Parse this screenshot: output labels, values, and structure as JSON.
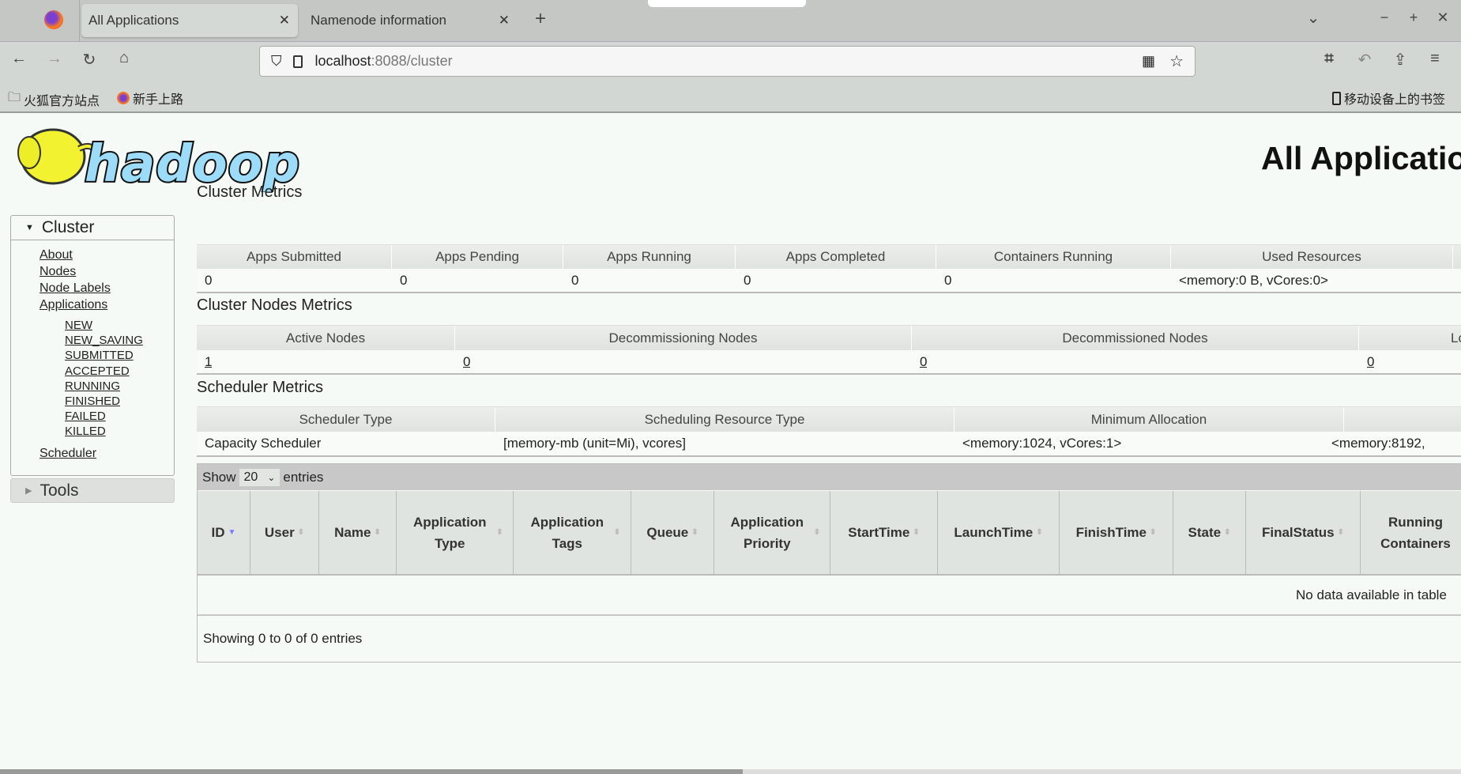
{
  "browser": {
    "tabs": [
      {
        "label": "All Applications",
        "active": true
      },
      {
        "label": "Namenode information",
        "active": false
      }
    ],
    "url_host": "localhost",
    "url_path": ":8088/cluster",
    "bookmarks": [
      "火狐官方站点",
      "新手上路"
    ],
    "mobile_bookmarks": "移动设备上的书签"
  },
  "page": {
    "title": "All Applications",
    "logo_text": "hadoop",
    "sidebar": {
      "cluster_label": "Cluster",
      "links": [
        "About",
        "Nodes",
        "Node Labels",
        "Applications"
      ],
      "app_states": [
        "NEW",
        "NEW_SAVING",
        "SUBMITTED",
        "ACCEPTED",
        "RUNNING",
        "FINISHED",
        "FAILED",
        "KILLED"
      ],
      "scheduler": "Scheduler",
      "tools_label": "Tools"
    },
    "cluster_metrics": {
      "heading": "Cluster Metrics",
      "headers": [
        "Apps Submitted",
        "Apps Pending",
        "Apps Running",
        "Apps Completed",
        "Containers Running",
        "Used Resources"
      ],
      "values": [
        "0",
        "0",
        "0",
        "0",
        "0",
        "<memory:0 B, vCores:0>"
      ]
    },
    "nodes_metrics": {
      "heading": "Cluster Nodes Metrics",
      "headers": [
        "Active Nodes",
        "Decommissioning Nodes",
        "Decommissioned Nodes",
        "Los"
      ],
      "values": [
        "1",
        "0",
        "0",
        "0"
      ]
    },
    "scheduler_metrics": {
      "heading": "Scheduler Metrics",
      "headers": [
        "Scheduler Type",
        "Scheduling Resource Type",
        "Minimum Allocation",
        ""
      ],
      "values": [
        "Capacity Scheduler",
        "[memory-mb (unit=Mi), vcores]",
        "<memory:1024, vCores:1>",
        "<memory:8192,"
      ]
    },
    "apps_table": {
      "show_label": "Show",
      "entries_value": "20",
      "entries_label": "entries",
      "columns": [
        "ID",
        "User",
        "Name",
        "Application Type",
        "Application Tags",
        "Queue",
        "Application Priority",
        "StartTime",
        "LaunchTime",
        "FinishTime",
        "State",
        "FinalStatus",
        "Running Containers"
      ],
      "empty_text": "No data available in table",
      "footer": "Showing 0 to 0 of 0 entries"
    }
  }
}
